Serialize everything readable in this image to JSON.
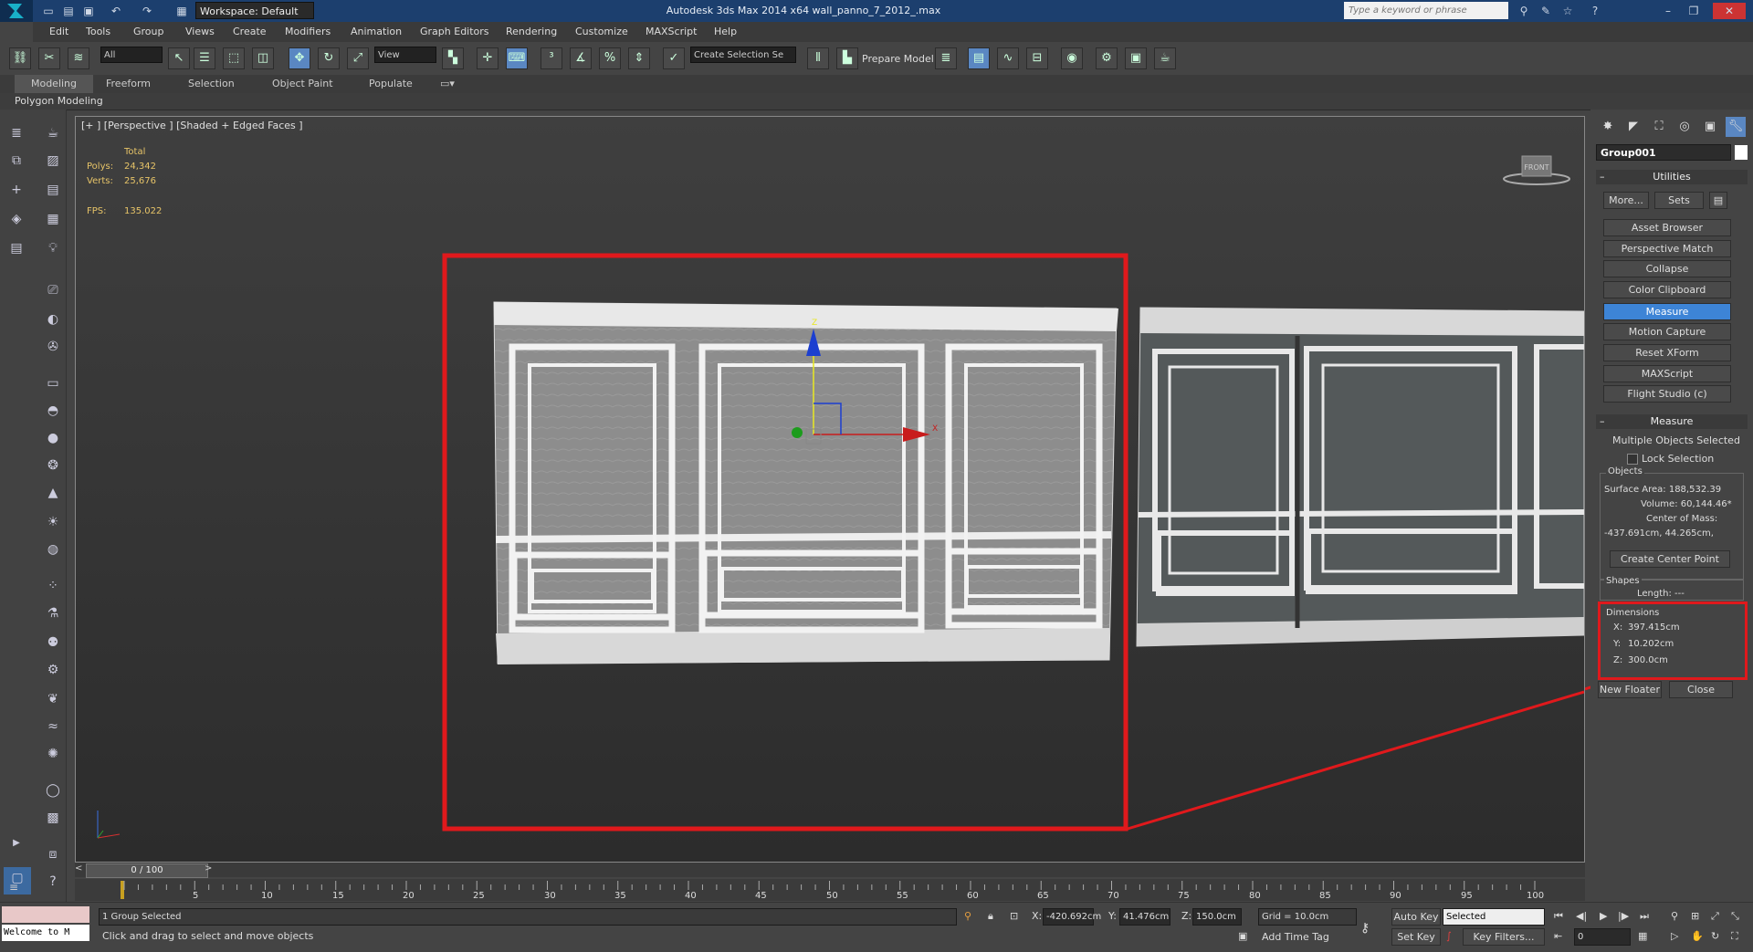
{
  "titlebar": {
    "workspace_label": "Workspace: Default",
    "app_title": "Autodesk 3ds Max  2014 x64     wall_panno_7_2012_.max",
    "search_placeholder": "Type a keyword or phrase"
  },
  "menu": [
    "Edit",
    "Tools",
    "Group",
    "Views",
    "Create",
    "Modifiers",
    "Animation",
    "Graph Editors",
    "Rendering",
    "Customize",
    "MAXScript",
    "Help"
  ],
  "toolbar": {
    "selection_filter": "All",
    "ref_coord": "View",
    "named_selection": "Create Selection Se",
    "prepare_model": "Prepare Model"
  },
  "ribbon": {
    "tabs": [
      "Modeling",
      "Freeform",
      "Selection",
      "Object Paint",
      "Populate"
    ],
    "sub_label": "Polygon Modeling"
  },
  "viewport": {
    "label": "[+ ] [Perspective ] [Shaded + Edged Faces ]",
    "stats_header": "Total",
    "polys_label": "Polys:",
    "polys_value": "24,342",
    "verts_label": "Verts:",
    "verts_value": "25,676",
    "fps_label": "FPS:",
    "fps_value": "135.022",
    "viewcube_label": "FRONT",
    "gizmo_z": "Z",
    "gizmo_x": "X",
    "accent_color": "#e0191c"
  },
  "command_panel": {
    "object_name": "Group001",
    "utilities": {
      "title": "Utilities",
      "more_label": "More...",
      "sets_label": "Sets",
      "buttons": [
        "Asset Browser",
        "Perspective Match",
        "Collapse",
        "Color Clipboard",
        "Measure",
        "Motion Capture",
        "Reset XForm",
        "MAXScript",
        "Flight Studio (c)"
      ],
      "active": "Measure"
    },
    "measure": {
      "title": "Measure",
      "status": "Multiple Objects Selected",
      "lock_selection": "Lock Selection",
      "objects_group": "Objects",
      "surface_area": "Surface Area: 188,532.39",
      "volume": "Volume: 60,144.46*",
      "center_of_mass_label": "Center of Mass:",
      "center_of_mass_value": "-437.691cm, 44.265cm,",
      "create_center_point": "Create Center Point",
      "shapes_group": "Shapes",
      "length": "Length: ---",
      "dimensions_group": "Dimensions",
      "dim_x_label": "X:",
      "dim_x": "397.415cm",
      "dim_y_label": "Y:",
      "dim_y": "10.202cm",
      "dim_z_label": "Z:",
      "dim_z": "300.0cm",
      "new_floater": "New Floater",
      "close": "Close"
    }
  },
  "timeline": {
    "frame_label": "0 / 100",
    "ticks": [
      "5",
      "10",
      "15",
      "20",
      "25",
      "30",
      "35",
      "40",
      "45",
      "50",
      "55",
      "60",
      "65",
      "70",
      "75",
      "80",
      "85",
      "90",
      "95",
      "100"
    ]
  },
  "status": {
    "listener": "Welcome to M",
    "selected": "1 Group Selected",
    "prompt": "Click and drag to select and move objects",
    "x_label": "X:",
    "x_value": "-420.692cm",
    "y_label": "Y:",
    "y_value": "41.476cm",
    "z_label": "Z:",
    "z_value": "150.0cm",
    "grid": "Grid = 10.0cm",
    "add_time_tag": "Add Time Tag",
    "auto_key": "Auto Key",
    "set_key": "Set Key",
    "key_mode": "Selected",
    "key_filters": "Key Filters...",
    "frame": "0"
  }
}
